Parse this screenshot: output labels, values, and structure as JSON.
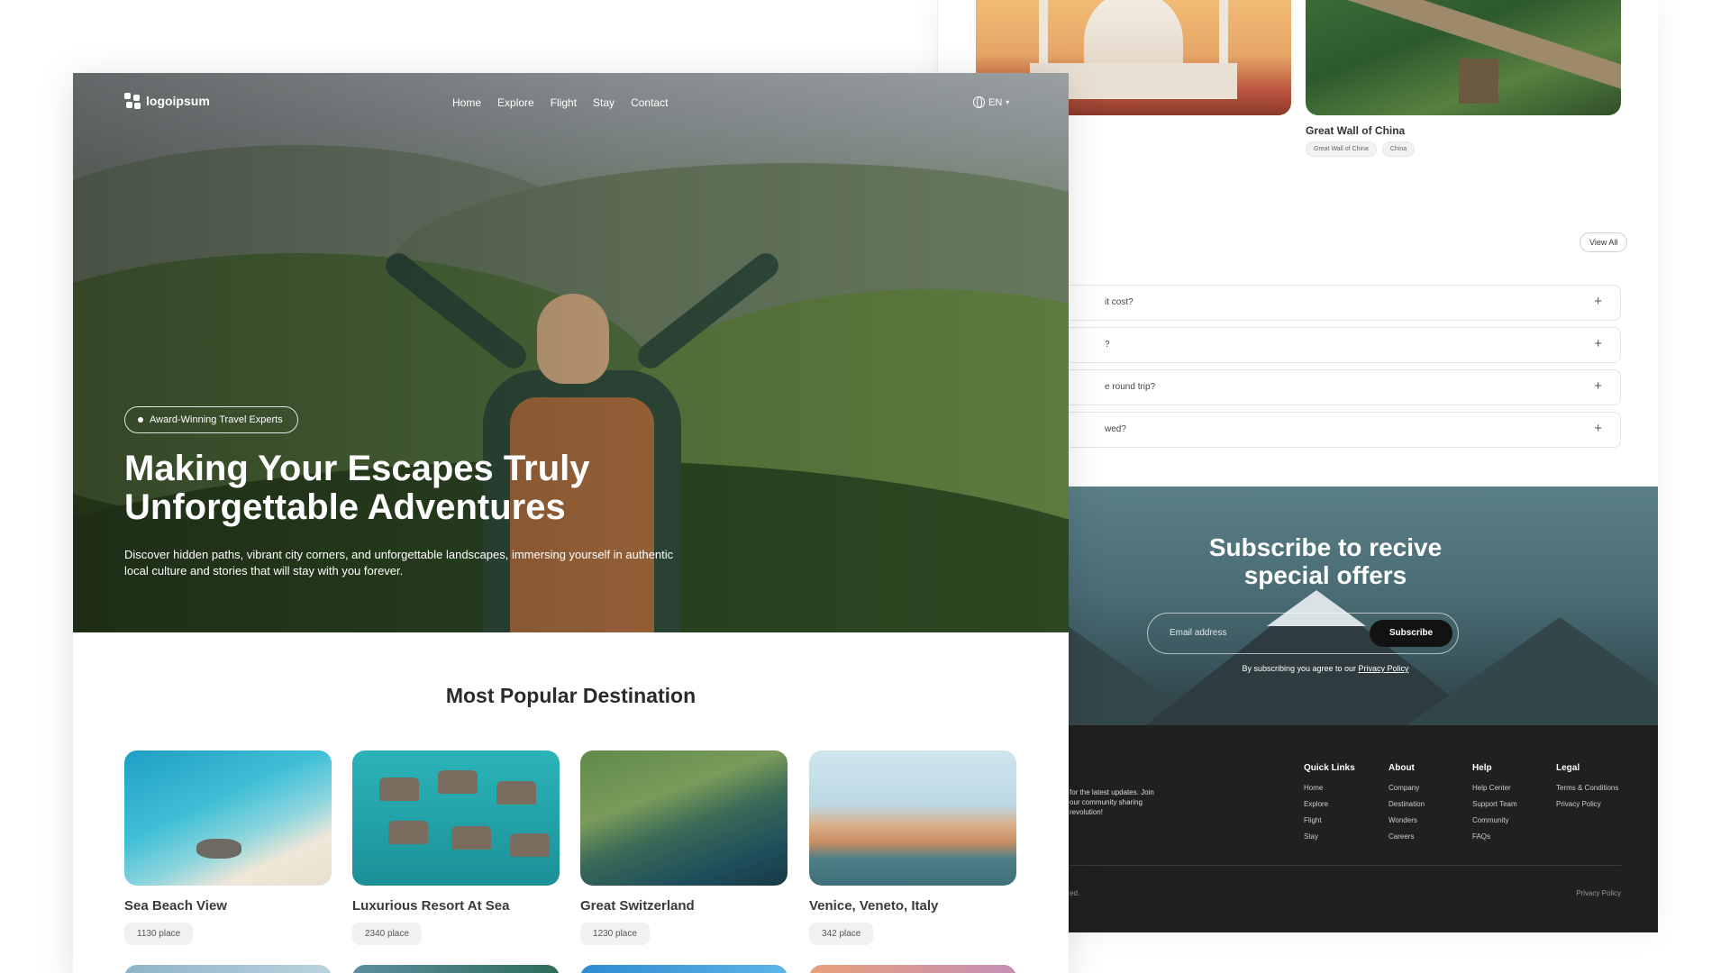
{
  "background_page": {
    "card_title": "Great Wall of China",
    "tags": [
      "Great Wall of China",
      "China"
    ],
    "view_all_label": "View All",
    "faqs": [
      "it cost?",
      "?",
      "e round trip?",
      "wed?"
    ],
    "subscribe": {
      "title_line1": "Subscribe to recive",
      "title_line2": "special offers",
      "email_placeholder": "Email address",
      "button_label": "Subscribe",
      "note_prefix": "By subscribing you agree to our ",
      "note_link": "Privacy Policy"
    },
    "footer": {
      "blurb": "for the latest updates. Join our community sharing revolution!",
      "columns": [
        {
          "heading": "Quick Links",
          "links": [
            "Home",
            "Explore",
            "Flight",
            "Stay"
          ]
        },
        {
          "heading": "About",
          "links": [
            "Company",
            "Destination",
            "Wonders",
            "Careers"
          ]
        },
        {
          "heading": "Help",
          "links": [
            "Help Center",
            "Support Team",
            "Community",
            "FAQs"
          ]
        },
        {
          "heading": "Legal",
          "links": [
            "Terms & Conditions",
            "Privacy Policy"
          ]
        }
      ],
      "copyright_fragment": "ed.",
      "privacy_label": "Privacy Policy"
    }
  },
  "nav": {
    "logo_text": "logoipsum",
    "links": [
      "Home",
      "Explore",
      "Flight",
      "Stay",
      "Contact"
    ],
    "language": "EN"
  },
  "hero": {
    "badge": "Award-Winning Travel Experts",
    "title_line1": "Making Your Escapes Truly",
    "title_line2": "Unforgettable Adventures",
    "description": "Discover hidden paths, vibrant city corners, and unforgettable landscapes, immersing yourself in authentic local culture and stories that will stay with you forever."
  },
  "popular": {
    "title": "Most Popular Destination",
    "destinations": [
      {
        "name": "Sea Beach View",
        "count": "1130 place"
      },
      {
        "name": "Luxurious Resort At Sea",
        "count": "2340 place"
      },
      {
        "name": "Great Switzerland",
        "count": "1230 place"
      },
      {
        "name": "Venice, Veneto, Italy",
        "count": "342 place"
      }
    ]
  }
}
